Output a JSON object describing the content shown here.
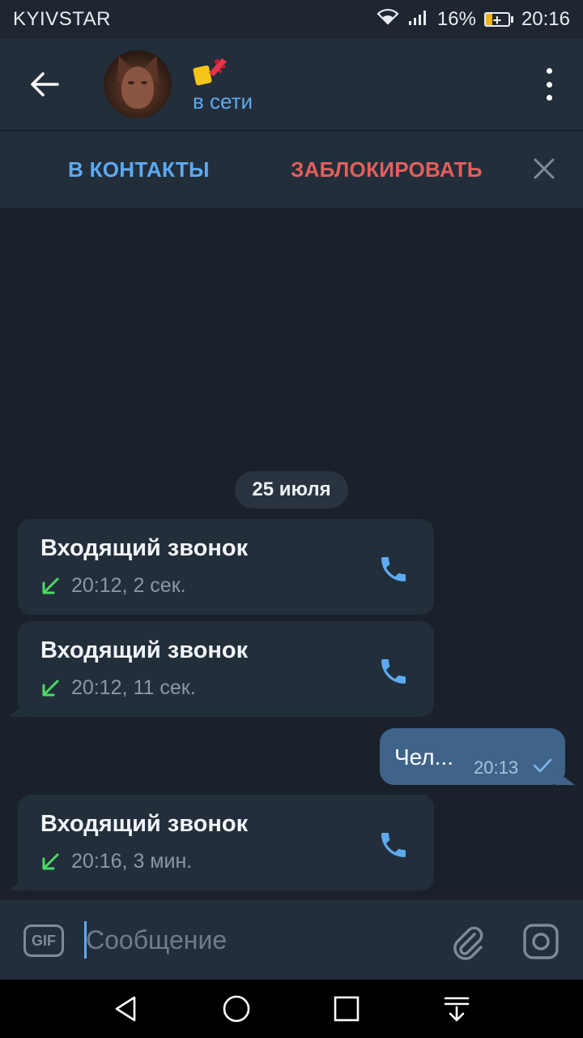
{
  "status_bar": {
    "carrier": "KYIVSTAR",
    "battery_percent": "16%",
    "battery_level": 0.16,
    "time": "20:16"
  },
  "header": {
    "contact_name_emoji": "💅",
    "status": "в сети"
  },
  "action_bar": {
    "add_contact_label": "В КОНТАКТЫ",
    "block_label": "ЗАБЛОКИРОВАТЬ"
  },
  "chat": {
    "date": "25 июля",
    "calls": [
      {
        "title": "Входящий звонок",
        "meta": "20:12, 2 сек."
      },
      {
        "title": "Входящий звонок",
        "meta": "20:12, 11 сек."
      },
      {
        "title": "Входящий звонок",
        "meta": "20:16, 3 мин."
      }
    ],
    "outgoing": {
      "text": "Чел...",
      "time": "20:13"
    }
  },
  "input": {
    "gif_label": "GIF",
    "placeholder": "Сообщение"
  },
  "colors": {
    "accent": "#5eaaf0",
    "danger": "#e2605c",
    "incoming_arrow": "#4cd964",
    "outgoing_bubble": "#3f6389"
  }
}
